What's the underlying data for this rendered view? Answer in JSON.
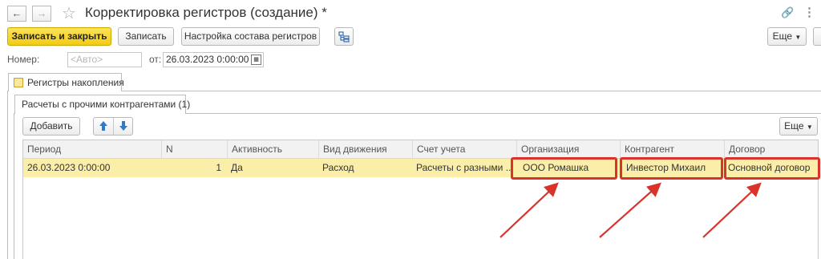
{
  "window": {
    "title": "Корректировка регистров (создание) *"
  },
  "toolbar": {
    "save_close_label": "Записать и закрыть",
    "save_label": "Записать",
    "configure_label": "Настройка состава регистров",
    "more_label": "Еще"
  },
  "header_fields": {
    "number_label": "Номер:",
    "number_placeholder": "<Авто>",
    "date_label": "от:",
    "date_value": "26.03.2023  0:00:00"
  },
  "tabs": {
    "main_tab": "Регистры накопления",
    "sub_tab": "Расчеты с прочими контрагентами (1)"
  },
  "grid_toolbar": {
    "add_label": "Добавить",
    "more_label": "Еще"
  },
  "grid": {
    "columns": [
      "Период",
      "N",
      "Активность",
      "Вид движения",
      "Счет учета",
      "Организация",
      "Контрагент",
      "Договор"
    ],
    "rows": [
      [
        "26.03.2023 0:00:00",
        "1",
        "Да",
        "Расход",
        "Расчеты с разными ...",
        "ООО Ромашка",
        "Инвестор Михаил",
        "Основной договор"
      ]
    ]
  },
  "colors": {
    "primary_button": "#f2cc12",
    "selected_row": "#fbeea9",
    "highlight": "#d8342c"
  }
}
